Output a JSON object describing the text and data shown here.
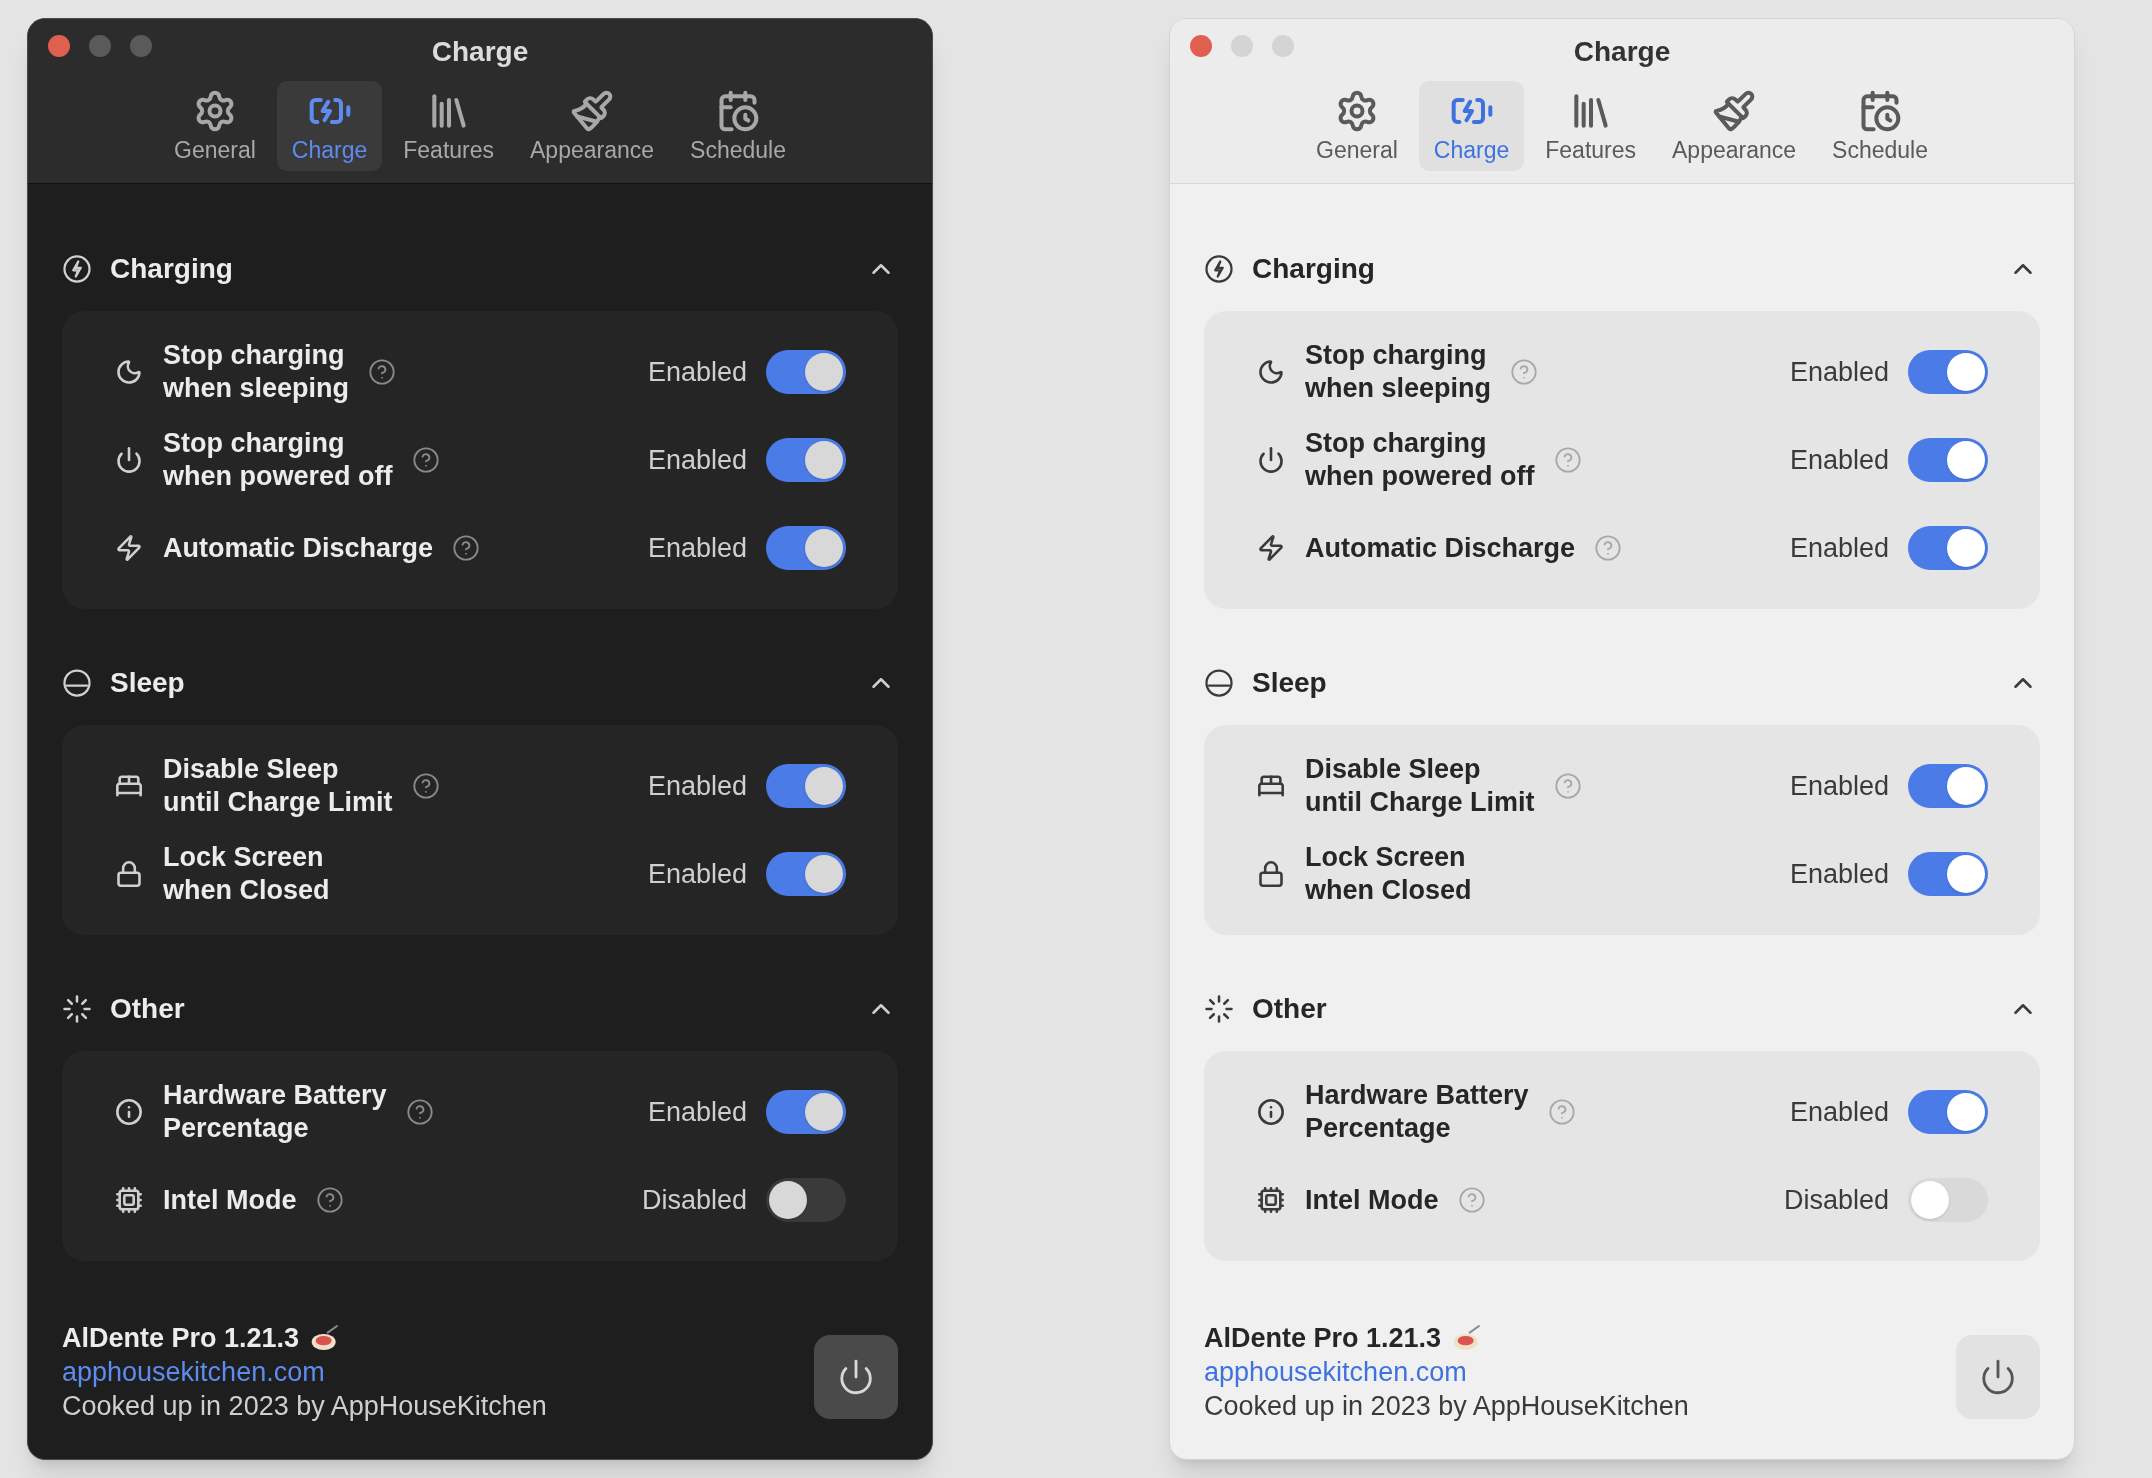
{
  "windows": [
    {
      "kind": "dark",
      "title": "Charge",
      "tabs": [
        {
          "label": "General",
          "selected": false
        },
        {
          "label": "Charge",
          "selected": true
        },
        {
          "label": "Features",
          "selected": false
        },
        {
          "label": "Appearance",
          "selected": false
        },
        {
          "label": "Schedule",
          "selected": false
        }
      ],
      "sections": [
        {
          "title": "Charging",
          "expanded": true,
          "rows": [
            {
              "lines": [
                "Stop charging",
                "when sleeping"
              ],
              "help": true,
              "status": "Enabled",
              "on": true
            },
            {
              "lines": [
                "Stop charging",
                "when powered off"
              ],
              "help": true,
              "status": "Enabled",
              "on": true
            },
            {
              "lines": [
                "Automatic Discharge"
              ],
              "help": true,
              "status": "Enabled",
              "on": true
            }
          ]
        },
        {
          "title": "Sleep",
          "expanded": true,
          "rows": [
            {
              "lines": [
                "Disable Sleep",
                "until Charge Limit"
              ],
              "help": true,
              "status": "Enabled",
              "on": true
            },
            {
              "lines": [
                "Lock Screen",
                "when Closed"
              ],
              "help": false,
              "status": "Enabled",
              "on": true
            }
          ]
        },
        {
          "title": "Other",
          "expanded": true,
          "rows": [
            {
              "lines": [
                "Hardware Battery",
                "Percentage"
              ],
              "help": true,
              "status": "Enabled",
              "on": true
            },
            {
              "lines": [
                "Intel Mode"
              ],
              "help": true,
              "status": "Disabled",
              "on": false
            }
          ]
        }
      ],
      "footer": {
        "app": "AlDente Pro 1.21.3",
        "link": "apphousekitchen.com",
        "credit": "Cooked up in 2023 by AppHouseKitchen"
      }
    },
    {
      "kind": "light",
      "title": "Charge",
      "tabs": [
        {
          "label": "General",
          "selected": false
        },
        {
          "label": "Charge",
          "selected": true
        },
        {
          "label": "Features",
          "selected": false
        },
        {
          "label": "Appearance",
          "selected": false
        },
        {
          "label": "Schedule",
          "selected": false
        }
      ],
      "sections": [
        {
          "title": "Charging",
          "expanded": true,
          "rows": [
            {
              "lines": [
                "Stop charging",
                "when sleeping"
              ],
              "help": true,
              "status": "Enabled",
              "on": true
            },
            {
              "lines": [
                "Stop charging",
                "when powered off"
              ],
              "help": true,
              "status": "Enabled",
              "on": true
            },
            {
              "lines": [
                "Automatic Discharge"
              ],
              "help": true,
              "status": "Enabled",
              "on": true
            }
          ]
        },
        {
          "title": "Sleep",
          "expanded": true,
          "rows": [
            {
              "lines": [
                "Disable Sleep",
                "until Charge Limit"
              ],
              "help": true,
              "status": "Enabled",
              "on": true
            },
            {
              "lines": [
                "Lock Screen",
                "when Closed"
              ],
              "help": false,
              "status": "Enabled",
              "on": true
            }
          ]
        },
        {
          "title": "Other",
          "expanded": true,
          "rows": [
            {
              "lines": [
                "Hardware Battery",
                "Percentage"
              ],
              "help": true,
              "status": "Enabled",
              "on": true
            },
            {
              "lines": [
                "Intel Mode"
              ],
              "help": true,
              "status": "Disabled",
              "on": false
            }
          ]
        }
      ],
      "footer": {
        "app": "AlDente Pro 1.21.3",
        "link": "apphousekitchen.com",
        "credit": "Cooked up in 2023 by AppHouseKitchen"
      }
    }
  ]
}
